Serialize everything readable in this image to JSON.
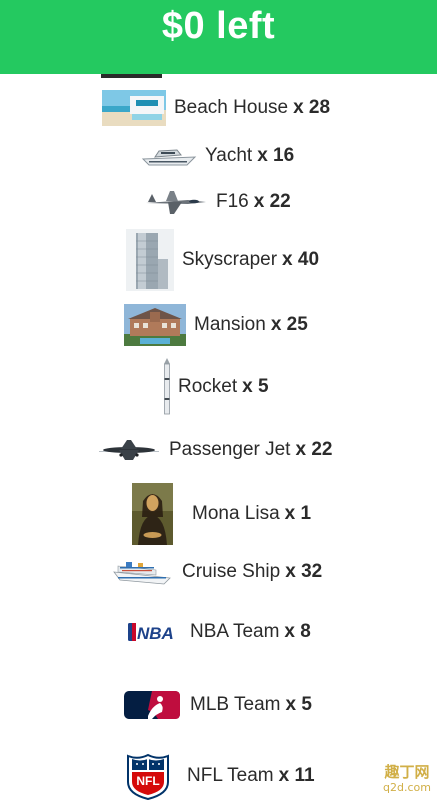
{
  "header": {
    "title": "$0 left",
    "background": "#24c960"
  },
  "items": [
    {
      "name": "Beach House",
      "qty": "x 28",
      "icon": "beach-house-photo"
    },
    {
      "name": "Yacht",
      "qty": "x 16",
      "icon": "yacht-photo"
    },
    {
      "name": "F16",
      "qty": "x 22",
      "icon": "f16-jet-photo"
    },
    {
      "name": "Skyscraper",
      "qty": "x 40",
      "icon": "skyscraper-photo"
    },
    {
      "name": "Mansion",
      "qty": "x 25",
      "icon": "mansion-photo"
    },
    {
      "name": "Rocket",
      "qty": "x 5",
      "icon": "rocket-photo"
    },
    {
      "name": "Passenger Jet",
      "qty": "x 22",
      "icon": "passenger-jet-photo"
    },
    {
      "name": "Mona Lisa",
      "qty": "x 1",
      "icon": "mona-lisa-painting"
    },
    {
      "name": "Cruise Ship",
      "qty": "x 32",
      "icon": "cruise-ship-photo"
    },
    {
      "name": "NBA Team",
      "qty": "x 8",
      "icon": "nba-logo"
    },
    {
      "name": "MLB Team",
      "qty": "x 5",
      "icon": "mlb-logo"
    },
    {
      "name": "NFL Team",
      "qty": "x 11",
      "icon": "nfl-logo"
    }
  ],
  "watermark": {
    "line1": "趣丁网",
    "line2": "q2d.com"
  }
}
